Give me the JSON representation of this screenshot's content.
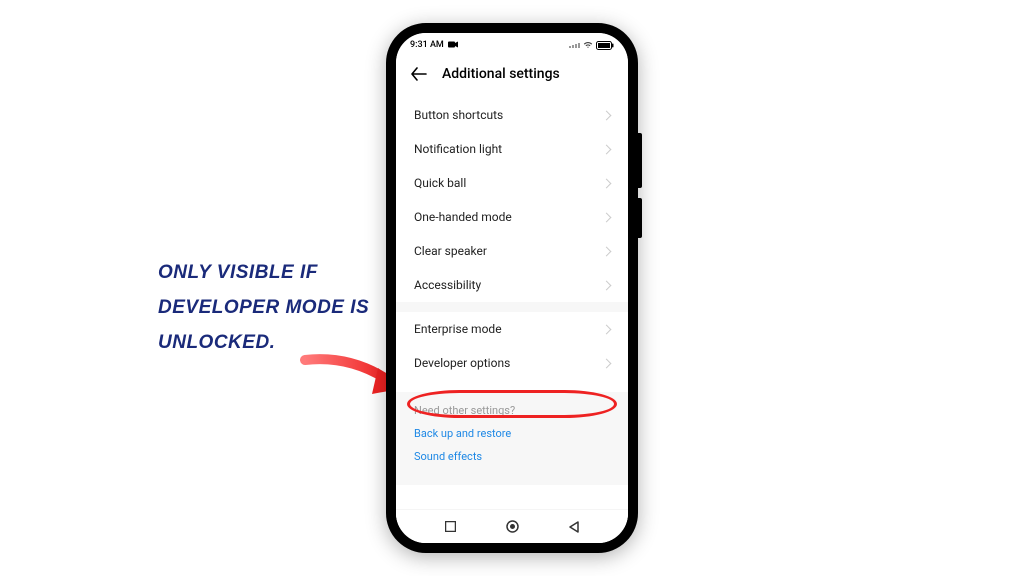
{
  "status": {
    "time": "9:31 AM"
  },
  "header": {
    "title": "Additional settings"
  },
  "list": {
    "partial": "···· ······ ·······",
    "items": [
      "Button shortcuts",
      "Notification light",
      "Quick ball",
      "One-handed mode",
      "Clear speaker",
      "Accessibility"
    ],
    "group2": [
      "Enterprise mode",
      "Developer options"
    ]
  },
  "footer": {
    "question": "Need other settings?",
    "links": [
      "Back up and restore",
      "Sound effects"
    ]
  },
  "annotation": {
    "text": "Only visible if developer mode is unlocked."
  }
}
